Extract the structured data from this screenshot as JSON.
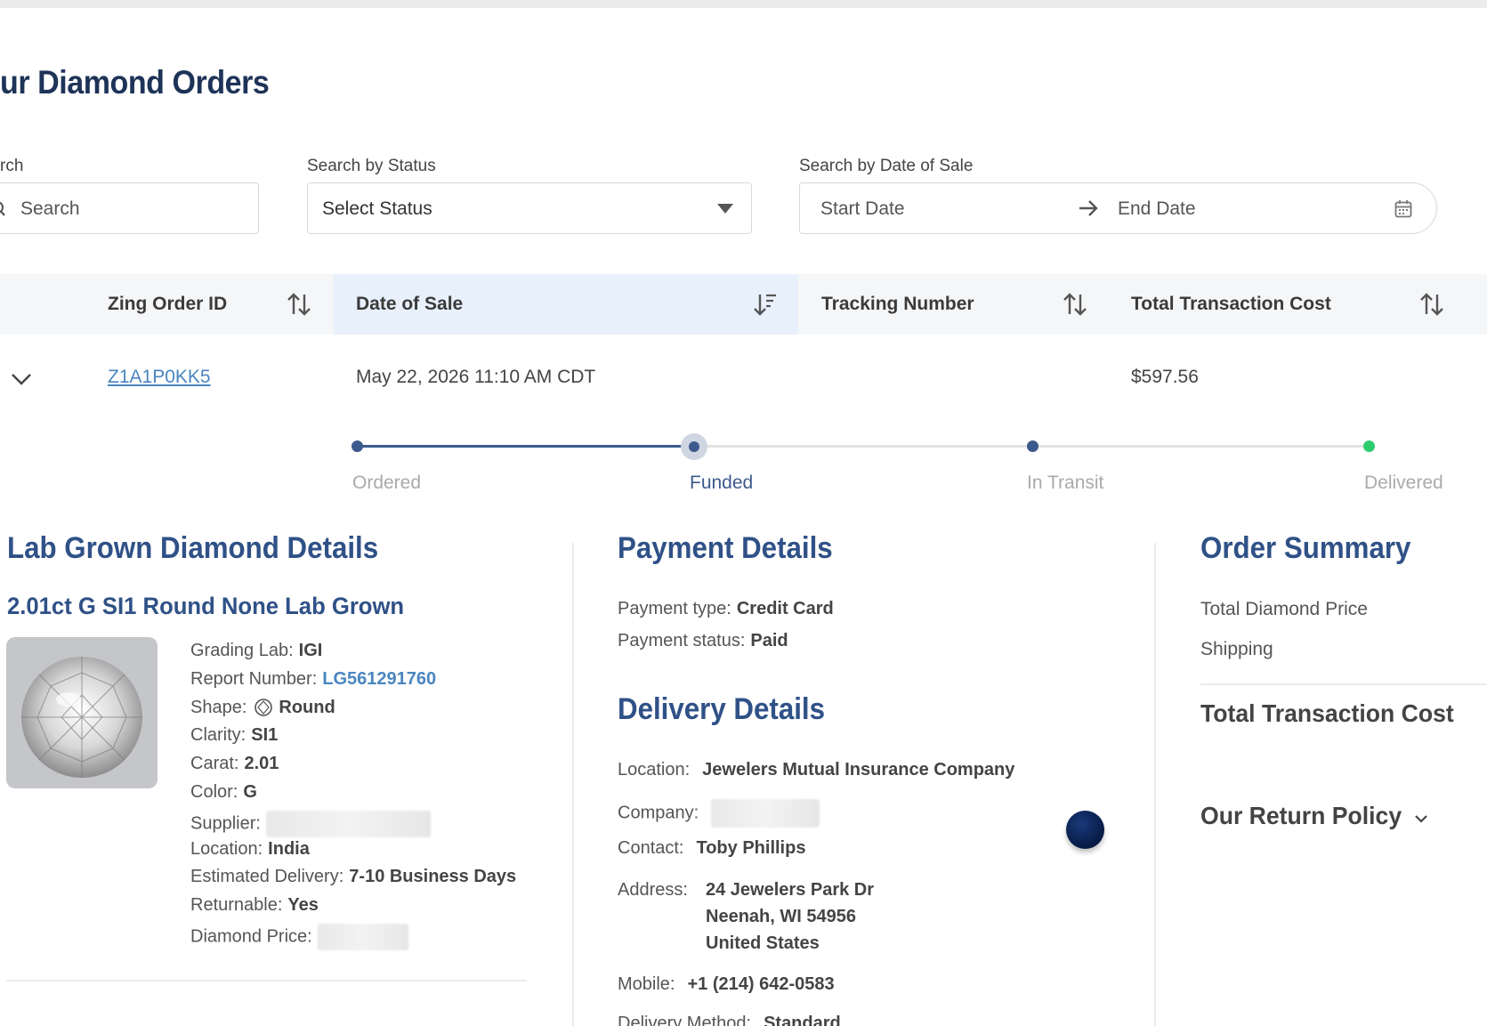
{
  "page": {
    "title": "ur Diamond Orders"
  },
  "filters": {
    "search_label": "rch",
    "search_placeholder": "Search",
    "status_label": "Search by Status",
    "status_value": "Select Status",
    "date_label": "Search by Date of Sale",
    "start_placeholder": "Start Date",
    "end_placeholder": "End Date"
  },
  "table": {
    "columns": [
      "Zing Order ID",
      "Date of Sale",
      "Tracking Number",
      "Total Transaction Cost"
    ],
    "rows": [
      {
        "order_id": "Z1A1P0KK5",
        "date_of_sale": "May 22, 2026 11:10 AM CDT",
        "tracking_number": "",
        "total": "$597.56"
      }
    ]
  },
  "progress": {
    "steps": [
      "Ordered",
      "Funded",
      "In Transit",
      "Delivered"
    ],
    "current_step": 2,
    "colors": {
      "active": "#3d5a8c",
      "inactive": "#e3e3e3",
      "delivered": "#2ecc71"
    }
  },
  "diamond": {
    "section_title": "Lab Grown Diamond Details",
    "name": "2.01ct G SI1 Round None Lab Grown",
    "fields": [
      {
        "label": "Grading Lab:",
        "value": "IGI"
      },
      {
        "label": "Report Number:",
        "value": "LG561291760"
      },
      {
        "label": "Shape:",
        "value": "Round"
      },
      {
        "label": "Clarity:",
        "value": "SI1"
      },
      {
        "label": "Carat:",
        "value": "2.01"
      },
      {
        "label": "Color:",
        "value": "G"
      },
      {
        "label": "Supplier:",
        "value": ""
      },
      {
        "label": "Location:",
        "value": "India"
      },
      {
        "label": "Estimated Delivery:",
        "value": "7-10 Business Days"
      },
      {
        "label": "Returnable:",
        "value": "Yes"
      },
      {
        "label": "Diamond Price:",
        "value": ""
      }
    ]
  },
  "payment": {
    "section_title": "Payment Details",
    "fields": [
      {
        "label": "Payment type:",
        "value": "Credit Card"
      },
      {
        "label": "Payment status:",
        "value": "Paid"
      }
    ]
  },
  "delivery": {
    "section_title": "Delivery Details",
    "location_label": "Location:",
    "location_value": "Jewelers Mutual Insurance Company",
    "company_label": "Company:",
    "company_value": "",
    "contact_label": "Contact:",
    "contact_value": "Toby Phillips",
    "address_label": "Address:",
    "address_lines": [
      "24 Jewelers Park Dr",
      "Neenah, WI 54956",
      "United States"
    ],
    "mobile_label": "Mobile:",
    "mobile_value": "+1 (214) 642-0583",
    "method_label": "Delivery Method:",
    "method_value": "Standard"
  },
  "summary": {
    "section_title": "Order Summary",
    "total_diamond_price_label": "Total Diamond Price",
    "shipping_label": "Shipping",
    "total_label": "Total Transaction Cost",
    "return_policy_label": "Our Return Policy"
  },
  "colors": {
    "title": "#1e3358",
    "section": "#2f5187",
    "link": "#4a86c0"
  }
}
